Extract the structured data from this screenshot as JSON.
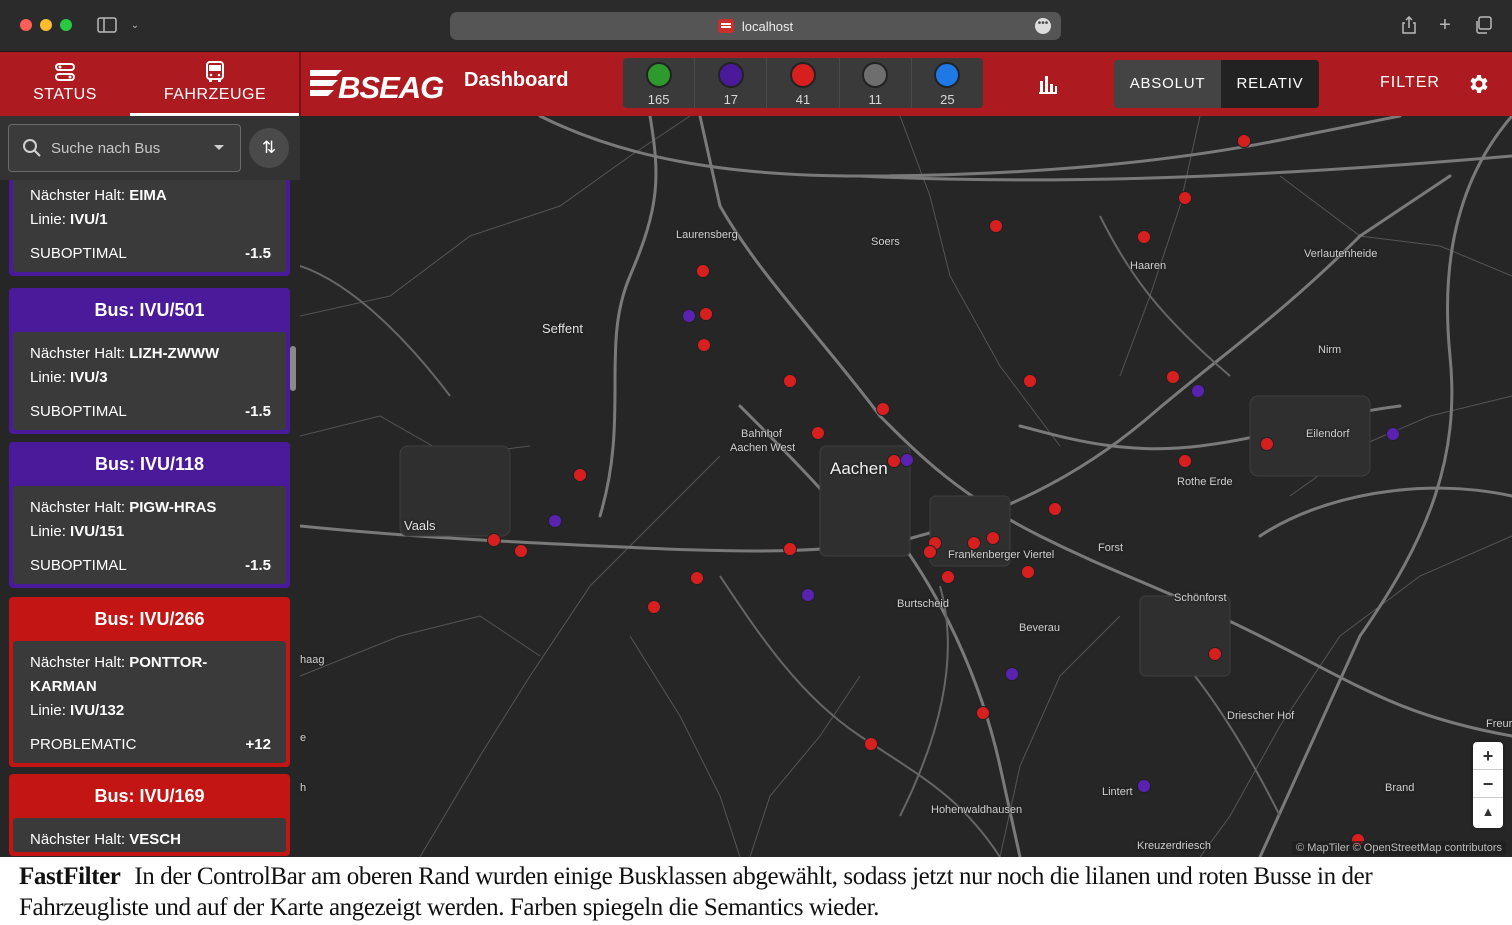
{
  "browser": {
    "url": "localhost"
  },
  "nav": {
    "status_label": "STATUS",
    "vehicles_label": "FAHRZEUGE"
  },
  "brand": {
    "logo_text": "BSEAG",
    "title": "Dashboard"
  },
  "counters": [
    {
      "color": "#2e9a2e",
      "count": "165"
    },
    {
      "color": "#4a1a9a",
      "count": "17"
    },
    {
      "color": "#d81f1f",
      "count": "41"
    },
    {
      "color": "#6e6e6e",
      "count": "11"
    },
    {
      "color": "#1e78e6",
      "count": "25"
    }
  ],
  "toggle": {
    "absolute_label": "ABSOLUT",
    "relative_label": "RELATIV"
  },
  "filter_label": "FILTER",
  "search": {
    "placeholder": "Suche nach Bus"
  },
  "cards": [
    {
      "title": "",
      "color": "purple",
      "stop_label": "Nächster Halt:",
      "stop": "EIMA",
      "line_label": "Linie:",
      "line": "IVU/1",
      "status": "SUBOPTIMAL",
      "score": "-1.5"
    },
    {
      "title": "Bus: IVU/501",
      "color": "purple",
      "stop_label": "Nächster Halt:",
      "stop": "LIZH-ZWWW",
      "line_label": "Linie:",
      "line": "IVU/3",
      "status": "SUBOPTIMAL",
      "score": "-1.5"
    },
    {
      "title": "Bus: IVU/118",
      "color": "purple",
      "stop_label": "Nächster Halt:",
      "stop": "PIGW-HRAS",
      "line_label": "Linie:",
      "line": "IVU/151",
      "status": "SUBOPTIMAL",
      "score": "-1.5"
    },
    {
      "title": "Bus: IVU/266",
      "color": "red",
      "stop_label": "Nächster Halt:",
      "stop": "PONTTOR-KARMAN",
      "line_label": "Linie:",
      "line": "IVU/132",
      "status": "PROBLEMATIC",
      "score": "+12"
    },
    {
      "title": "Bus: IVU/169",
      "color": "red",
      "stop_label": "Nächster Halt:",
      "stop": "VESCH",
      "line_label": "",
      "line": "",
      "status": "",
      "score": ""
    }
  ],
  "map": {
    "places": {
      "laurensberg": "Laurensberg",
      "soers": "Soers",
      "haaren": "Haaren",
      "verlautenheide": "Verlautenheide",
      "seffent": "Seffent",
      "nirm": "Nirm",
      "bahnhof": "Bahnhof",
      "aachen_west": "Aachen West",
      "aachen": "Aachen",
      "eilendorf": "Eilendorf",
      "rothe_erde": "Rothe Erde",
      "vaals": "Vaals",
      "forst": "Forst",
      "frankenberger": "Frankenberger Viertel",
      "burtscheid": "Burtscheid",
      "schoenforst": "Schönforst",
      "beverau": "Beverau",
      "haag": "haag",
      "driescher": "Driescher Hof",
      "freund": "Freur",
      "brand": "Brand",
      "lintert": "Lintert",
      "hohenwaldhausen": "Hohenwaldhausen",
      "kreuzerdriesch": "Kreuzerdriesch",
      "h_edge": "h",
      "e_edge": "e"
    },
    "zoom_in": "+",
    "zoom_out": "−",
    "compass": "▲",
    "attribution": "© MapTiler © OpenStreetMap contributors"
  },
  "caption": {
    "title": "FastFilter",
    "text": "In der ControlBar am oberen Rand wurden einige Busklassen abgewählt, sodass jetzt nur noch die lilanen und roten Busse in der Fahrzeugliste und auf der Karte angezeigt werden. Farben spiegeln die Semantics wieder."
  }
}
